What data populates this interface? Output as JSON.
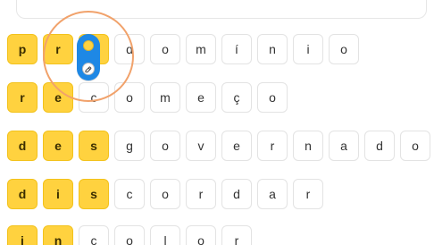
{
  "colors": {
    "highlight_yellow": "#FFD23F",
    "focus_orange": "#F1A26B",
    "handle_blue": "#1E88E5"
  },
  "rows": [
    {
      "letters": [
        "p",
        "r",
        "e",
        "d",
        "o",
        "m",
        "í",
        "n",
        "i",
        "o"
      ],
      "highlighted": 3
    },
    {
      "letters": [
        "r",
        "e",
        "c",
        "o",
        "m",
        "e",
        "ç",
        "o"
      ],
      "highlighted": 2
    },
    {
      "letters": [
        "d",
        "e",
        "s",
        "g",
        "o",
        "v",
        "e",
        "r",
        "n",
        "a",
        "d",
        "o"
      ],
      "highlighted": 3
    },
    {
      "letters": [
        "d",
        "i",
        "s",
        "c",
        "o",
        "r",
        "d",
        "a",
        "r"
      ],
      "highlighted": 3
    },
    {
      "letters": [
        "i",
        "n",
        "c",
        "o",
        "l",
        "o",
        "r"
      ],
      "highlighted": 2
    }
  ],
  "handle": {
    "icon": "eraser-icon"
  }
}
